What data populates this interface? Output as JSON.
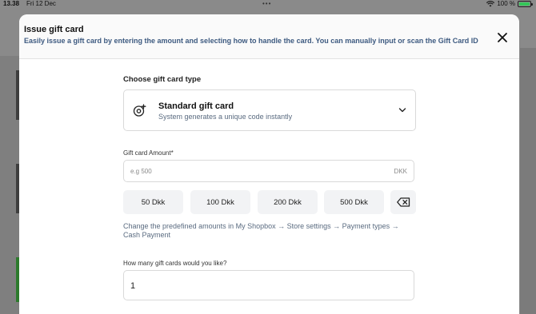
{
  "status_bar": {
    "time": "13.38",
    "date": "Fri 12 Dec",
    "dots": "•••",
    "battery": "100 %",
    "battery_level": 1.0
  },
  "modal": {
    "title": "Issue gift card",
    "subtitle": "Easily issue a gift card by entering the amount and selecting how to handle the card. You can manually input or scan the Gift Card ID",
    "close_icon": "close-icon"
  },
  "gift_card_type": {
    "label": "Choose gift card type",
    "selected_title": "Standard gift card",
    "selected_description": "System generates a unique code instantly",
    "icon": "gift-card-target-icon"
  },
  "amount": {
    "label": "Gift card Amount*",
    "placeholder": "e.g 500",
    "value": "",
    "currency": "DKK",
    "presets": [
      "50 Dkk",
      "100 Dkk",
      "200 Dkk",
      "500 Dkk"
    ],
    "backspace_icon": "backspace-icon"
  },
  "hint": "Change the predefined amounts in My Shopbox → Store settings → Payment types → Cash Payment",
  "quantity": {
    "label": "How many gift cards would you like?",
    "value": "1"
  },
  "colors": {
    "subtitle": "#3d5a80",
    "battery": "#34c759",
    "preset_bg": "#f2f3f5"
  }
}
